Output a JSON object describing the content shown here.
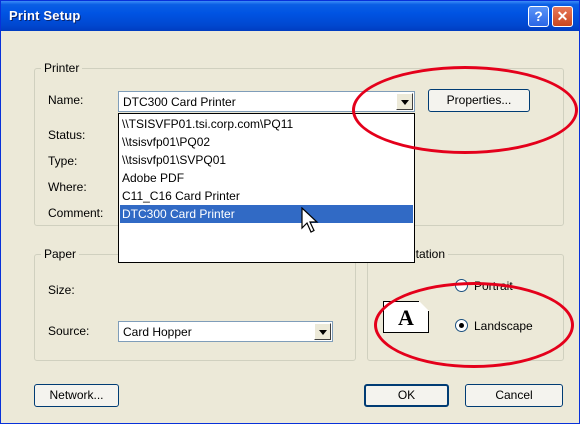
{
  "window": {
    "title": "Print Setup",
    "help_glyph": "?",
    "close_glyph": "✕"
  },
  "printer": {
    "group_label": "Printer",
    "name_label": "Name:",
    "name_value": "DTC300 Card Printer",
    "status_label": "Status:",
    "type_label": "Type:",
    "where_label": "Where:",
    "comment_label": "Comment:",
    "properties_label": "Properties...",
    "dropdown_options": [
      "\\\\TSISVFP01.tsi.corp.com\\PQ11",
      "\\\\tsisvfp01\\PQ02",
      "\\\\tsisvfp01\\SVPQ01",
      "Adobe PDF",
      "C11_C16 Card Printer",
      "DTC300 Card Printer"
    ],
    "selected_option": "DTC300 Card Printer"
  },
  "paper": {
    "group_label": "Paper",
    "size_label": "Size:",
    "source_label": "Source:",
    "source_value": "Card Hopper"
  },
  "orientation": {
    "group_label_visible": "ntation",
    "page_icon_letter": "A",
    "portrait_label": "Portrait",
    "landscape_label": "Landscape",
    "selected": "Landscape"
  },
  "buttons": {
    "network": "Network...",
    "ok": "OK",
    "cancel": "Cancel"
  },
  "colors": {
    "title_bar": "#0054e3",
    "selection": "#316ac5",
    "annotation": "#e4001b",
    "dialog_bg": "#ece9d8"
  }
}
